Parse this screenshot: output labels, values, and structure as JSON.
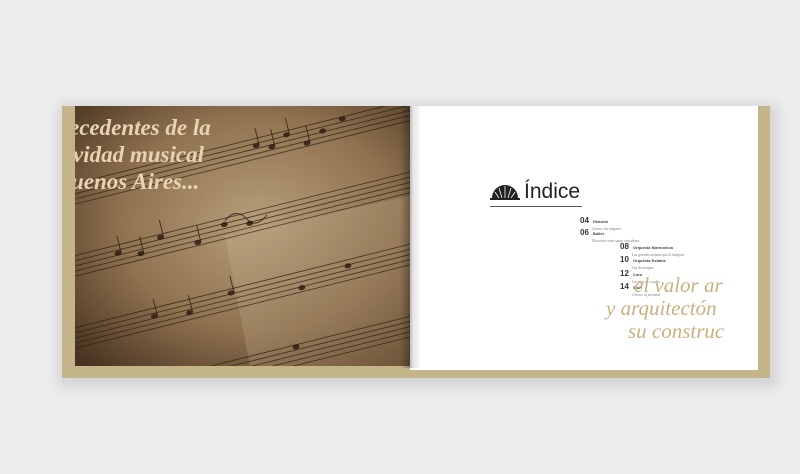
{
  "left_page": {
    "headline_lines": [
      "ecedentes de la",
      "vidad musical",
      "uenos Aires..."
    ]
  },
  "right_page": {
    "index_title": "Índice",
    "toc": [
      {
        "num": "04",
        "name": "Historia",
        "desc": "Conoce los orígenes"
      },
      {
        "num": "06",
        "name": "Ballet",
        "desc": "Descubre cómo surge esta danza"
      },
      {
        "num": "08",
        "name": "Orquesta filarmónica",
        "desc": "Los grandes artistas que la integran"
      },
      {
        "num": "10",
        "name": "Orquesta Estable",
        "desc": "Luz de tiempos"
      },
      {
        "num": "12",
        "name": "Coro",
        "desc": "Coristas de a pulso"
      },
      {
        "num": "14",
        "name": "Staff",
        "desc": "Conoce al personal"
      }
    ],
    "headline_lines": [
      "el valor ar",
      "y arquitectón",
      "su construc"
    ]
  },
  "colors": {
    "gold": "#c4b48a",
    "headline_gold": "#c9b07f",
    "sepia": "#7a6042"
  }
}
